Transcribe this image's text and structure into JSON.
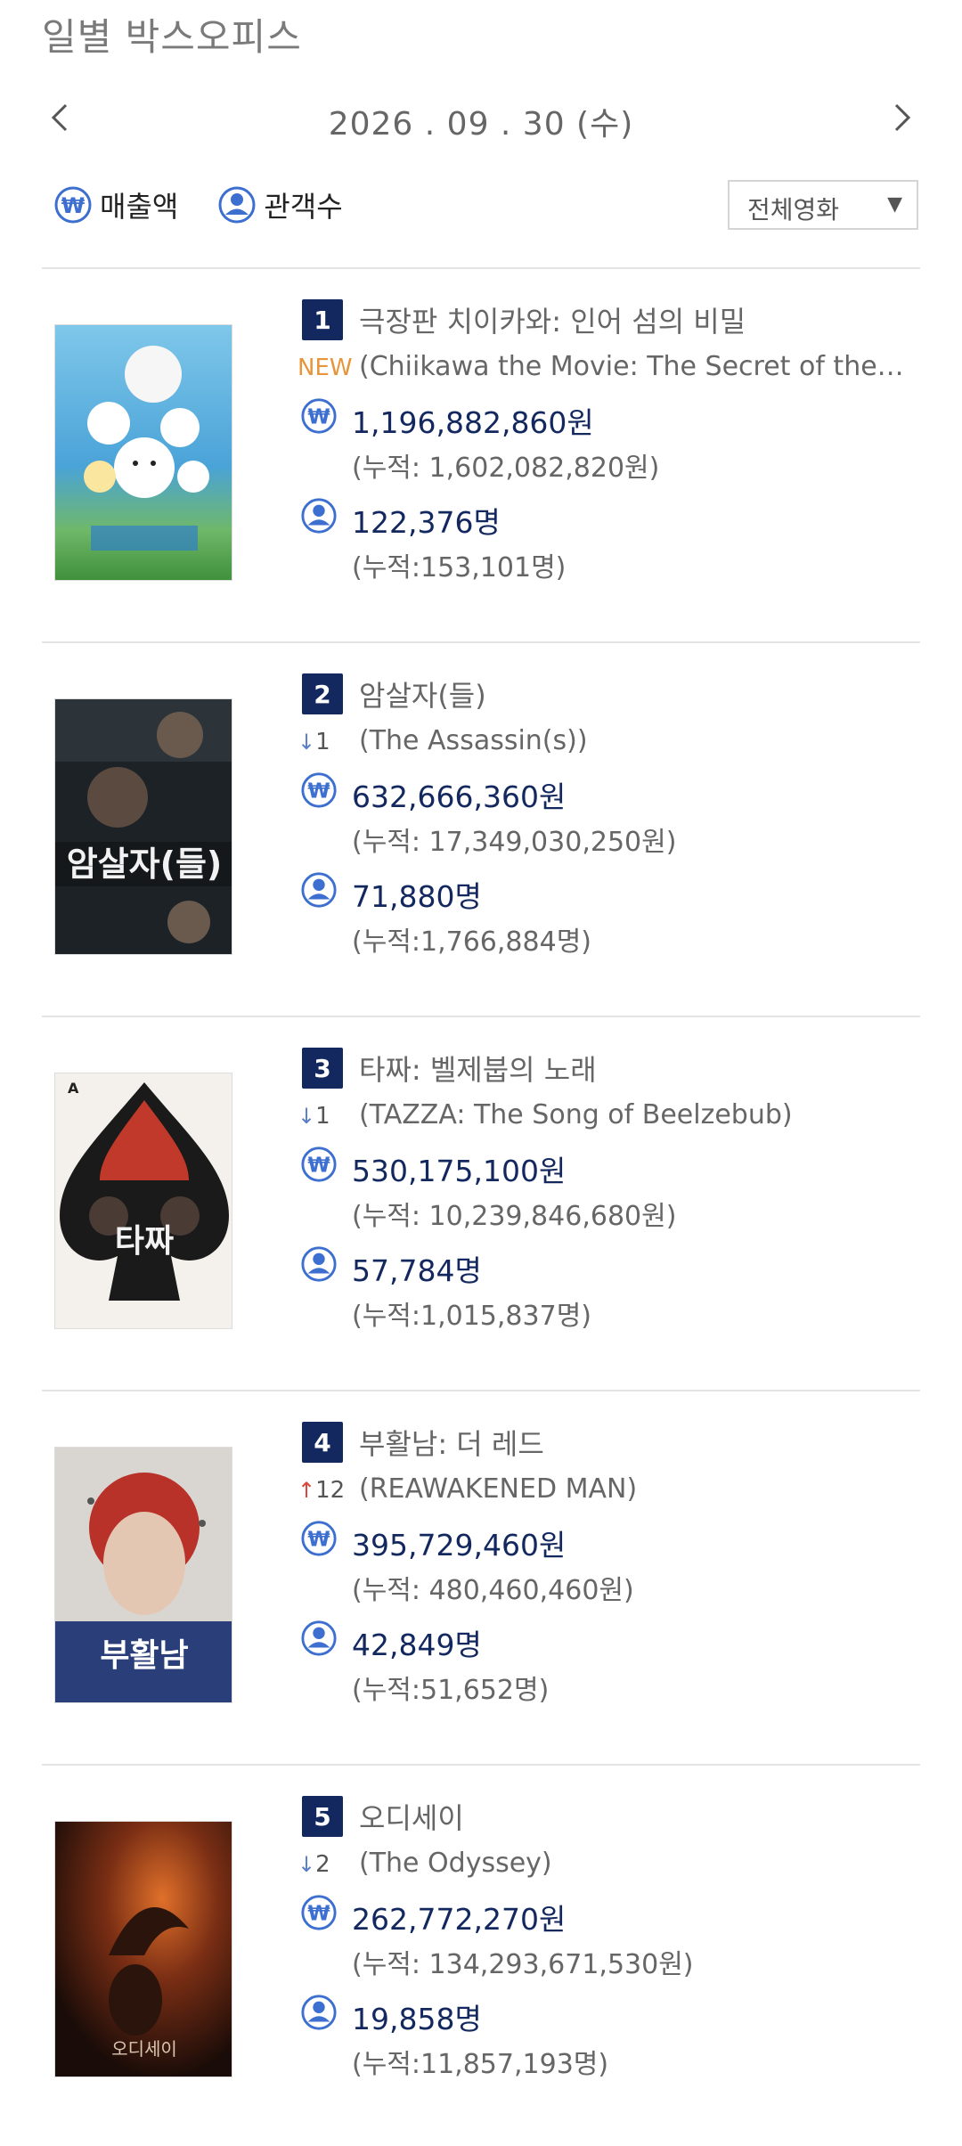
{
  "page": {
    "title": "일별 박스오피스"
  },
  "date_nav": {
    "date": "2026 . 09 . 30  (수)"
  },
  "toggles": {
    "sales_label": "매출액",
    "audience_label": "관객수"
  },
  "filter": {
    "selected": "전체영화"
  },
  "colors": {
    "navy": "#13285f",
    "new": "#e6953a",
    "down": "#5b7fc7",
    "up": "#d9453b"
  },
  "movies": [
    {
      "rank": "1",
      "title": "극장판 치이카와: 인어 섬의 비밀",
      "change": "NEW",
      "eng_title": "(Chiikawa the Movie: The Secret of the Mermaid Island)",
      "sales": "1,196,882,860원",
      "sales_cumulative": "(누적: 1,602,082,820원)",
      "audience": "122,376명",
      "audience_cumulative": "(누적:153,101명)"
    },
    {
      "rank": "2",
      "title": "암살자(들)",
      "change": "1",
      "eng_title": "(The Assassin(s))",
      "sales": "632,666,360원",
      "sales_cumulative": "(누적: 17,349,030,250원)",
      "audience": "71,880명",
      "audience_cumulative": "(누적:1,766,884명)",
      "poster_text": "암살자(들)"
    },
    {
      "rank": "3",
      "title": "타짜: 벨제붑의 노래",
      "change": "1",
      "eng_title": "(TAZZA: The Song of Beelzebub)",
      "sales": "530,175,100원",
      "sales_cumulative": "(누적: 10,239,846,680원)",
      "audience": "57,784명",
      "audience_cumulative": "(누적:1,015,837명)",
      "poster_text": "타짜"
    },
    {
      "rank": "4",
      "title": "부활남: 더 레드",
      "change": "12",
      "eng_title": "(REAWAKENED MAN)",
      "sales": "395,729,460원",
      "sales_cumulative": "(누적: 480,460,460원)",
      "audience": "42,849명",
      "audience_cumulative": "(누적:51,652명)",
      "poster_text": "부활남"
    },
    {
      "rank": "5",
      "title": "오디세이",
      "change": "2",
      "eng_title": "(The Odyssey)",
      "sales": "262,772,270원",
      "sales_cumulative": "(누적: 134,293,671,530원)",
      "audience": "19,858명",
      "audience_cumulative": "(누적:11,857,193명)",
      "poster_text": "오디세이"
    }
  ]
}
